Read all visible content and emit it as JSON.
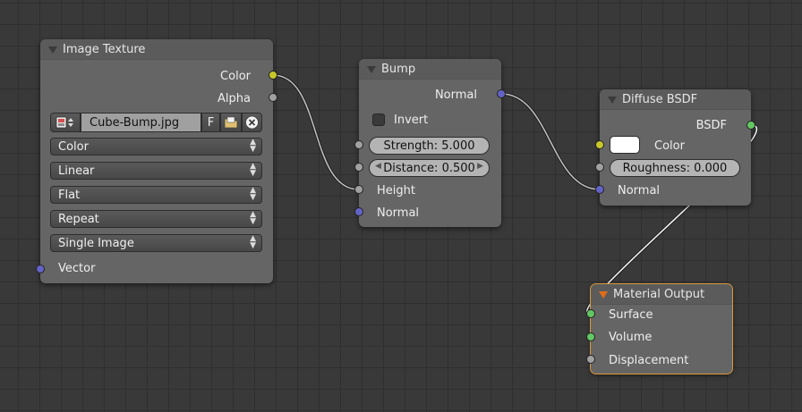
{
  "editor": "Node Editor",
  "nodes": {
    "image_texture": {
      "title": "Image Texture",
      "outputs": [
        "Color",
        "Alpha"
      ],
      "file": {
        "name": "Cube-Bump.jpg",
        "fake_user_label": "F",
        "icons": [
          "image-browse-icon",
          "open-folder-icon",
          "unlink-icon"
        ]
      },
      "color_space": "Color",
      "interpolation": "Linear",
      "projection": "Flat",
      "extension": "Repeat",
      "source": "Single Image",
      "inputs": [
        "Vector"
      ]
    },
    "bump": {
      "title": "Bump",
      "outputs": [
        "Normal"
      ],
      "invert_label": "Invert",
      "invert_checked": false,
      "strength_label": "Strength:",
      "strength_value": "5.000",
      "distance_label": "Distance:",
      "distance_value": "0.500",
      "inputs": [
        "Height",
        "Normal"
      ]
    },
    "diffuse": {
      "title": "Diffuse BSDF",
      "outputs": [
        "BSDF"
      ],
      "color_label": "Color",
      "color_value": "#ffffff",
      "roughness_label": "Roughness:",
      "roughness_value": "0.000",
      "inputs": [
        "Normal"
      ]
    },
    "material_output": {
      "title": "Material Output",
      "active": true,
      "inputs": [
        "Surface",
        "Volume",
        "Displacement"
      ]
    }
  },
  "socket_colors": {
    "color": "#c7c729",
    "float": "#a1a1a1",
    "vector": "#6363c7",
    "shader": "#63c763"
  },
  "accent_colors": {
    "active_node_outline": "#d99a3a",
    "active_node_triangle": "#e06d1a"
  }
}
